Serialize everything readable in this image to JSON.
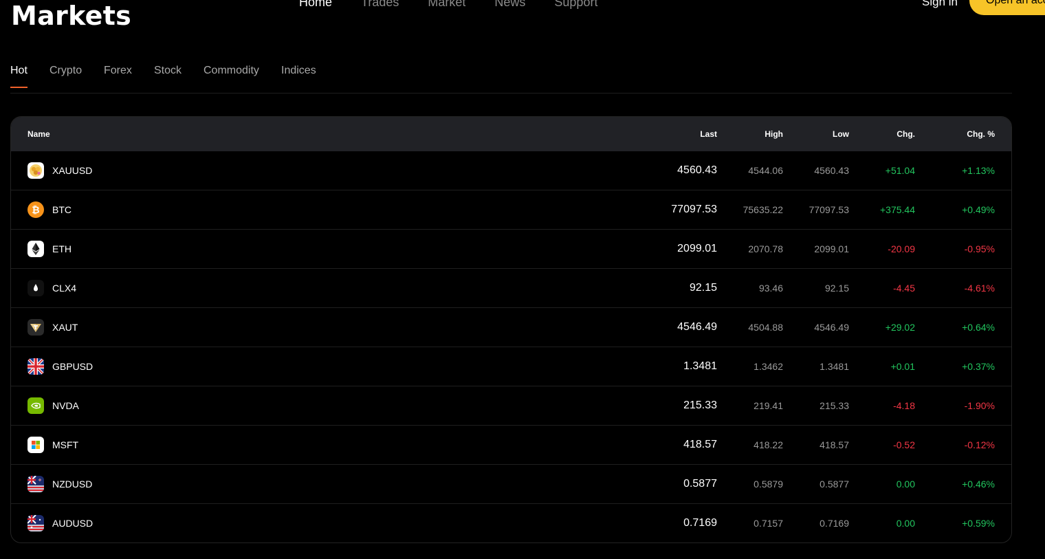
{
  "header": {
    "title": "Markets",
    "nav": [
      {
        "label": "Home",
        "active": true
      },
      {
        "label": "Trades",
        "active": false
      },
      {
        "label": "Market",
        "active": false
      },
      {
        "label": "News",
        "active": false
      },
      {
        "label": "Support",
        "active": false
      }
    ],
    "sign_in": "Sign in",
    "open_account": "Open an account"
  },
  "tabs": [
    {
      "label": "Hot",
      "active": true
    },
    {
      "label": "Crypto",
      "active": false
    },
    {
      "label": "Forex",
      "active": false
    },
    {
      "label": "Stock",
      "active": false
    },
    {
      "label": "Commodity",
      "active": false
    },
    {
      "label": "Indices",
      "active": false
    }
  ],
  "table": {
    "columns": {
      "name": "Name",
      "last": "Last",
      "high": "High",
      "low": "Low",
      "chg": "Chg.",
      "chg_pct": "Chg. %"
    },
    "rows": [
      {
        "symbol": "XAUUSD",
        "icon": "gold-coin-icon",
        "last": "4560.43",
        "high": "4544.06",
        "low": "4560.43",
        "chg": "+51.04",
        "chg_pct": "+1.13%",
        "dir": "up"
      },
      {
        "symbol": "BTC",
        "icon": "bitcoin-icon",
        "last": "77097.53",
        "high": "75635.22",
        "low": "77097.53",
        "chg": "+375.44",
        "chg_pct": "+0.49%",
        "dir": "up"
      },
      {
        "symbol": "ETH",
        "icon": "ethereum-icon",
        "last": "2099.01",
        "high": "2070.78",
        "low": "2099.01",
        "chg": "-20.09",
        "chg_pct": "-0.95%",
        "dir": "down"
      },
      {
        "symbol": "CLX4",
        "icon": "oil-drop-icon",
        "last": "92.15",
        "high": "93.46",
        "low": "92.15",
        "chg": "-4.45",
        "chg_pct": "-4.61%",
        "dir": "down"
      },
      {
        "symbol": "XAUT",
        "icon": "tether-gold-icon",
        "last": "4546.49",
        "high": "4504.88",
        "low": "4546.49",
        "chg": "+29.02",
        "chg_pct": "+0.64%",
        "dir": "up"
      },
      {
        "symbol": "GBPUSD",
        "icon": "uk-flag-icon",
        "last": "1.3481",
        "high": "1.3462",
        "low": "1.3481",
        "chg": "+0.01",
        "chg_pct": "+0.37%",
        "dir": "up"
      },
      {
        "symbol": "NVDA",
        "icon": "nvidia-icon",
        "last": "215.33",
        "high": "219.41",
        "low": "215.33",
        "chg": "-4.18",
        "chg_pct": "-1.90%",
        "dir": "down"
      },
      {
        "symbol": "MSFT",
        "icon": "microsoft-icon",
        "last": "418.57",
        "high": "418.22",
        "low": "418.57",
        "chg": "-0.52",
        "chg_pct": "-0.12%",
        "dir": "down"
      },
      {
        "symbol": "NZDUSD",
        "icon": "nz-flag-icon",
        "last": "0.5877",
        "high": "0.5879",
        "low": "0.5877",
        "chg": "0.00",
        "chg_pct": "+0.46%",
        "dir": "up"
      },
      {
        "symbol": "AUDUSD",
        "icon": "au-flag-icon",
        "last": "0.7169",
        "high": "0.7157",
        "low": "0.7169",
        "chg": "0.00",
        "chg_pct": "+0.59%",
        "dir": "up"
      }
    ]
  },
  "colors": {
    "accent": "#f0612b",
    "button": "#f7c428",
    "up": "#22c55e",
    "down": "#f23645",
    "header_bg": "#212226"
  }
}
